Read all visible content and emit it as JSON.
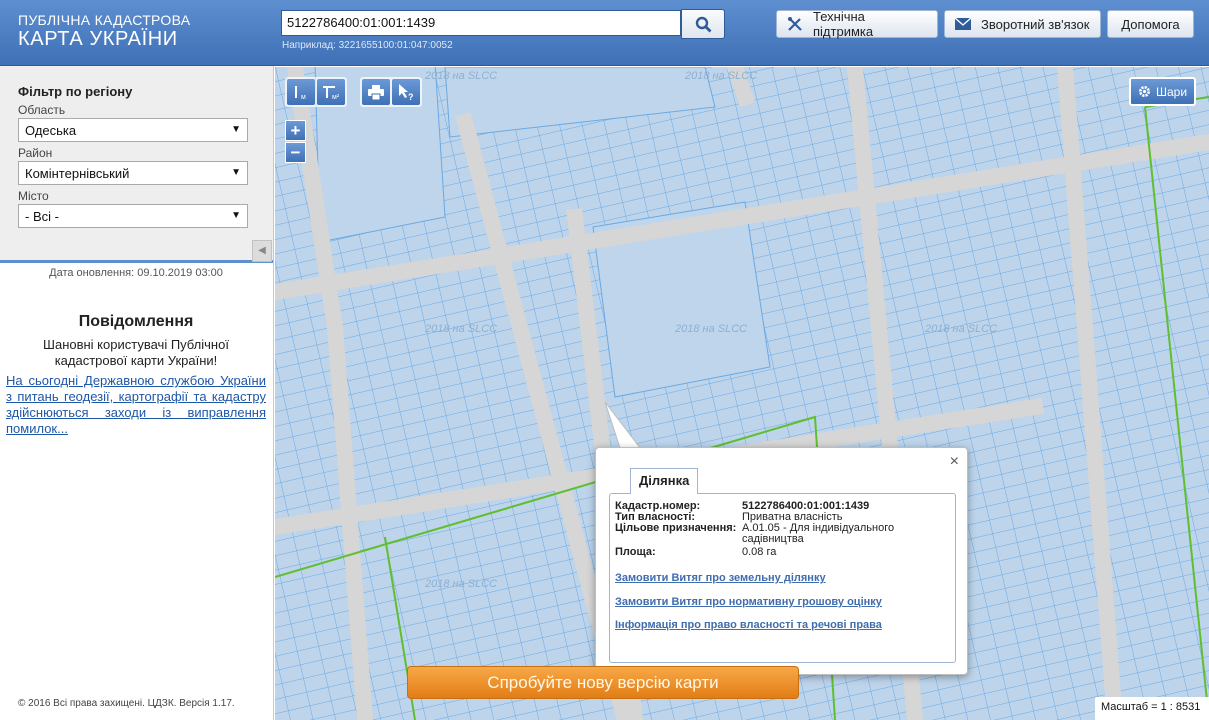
{
  "header": {
    "logo_line1": "ПУБЛІЧНА КАДАСТРОВА",
    "logo_line2": "КАРТА УКРАЇНИ",
    "search_value": "5122786400:01:001:1439",
    "search_hint": "Наприклад: 3221655100:01:047:0052",
    "btn_support": "Технічна підтримка",
    "btn_feedback": "Зворотний зв'язок",
    "btn_help": "Допомога"
  },
  "sidebar": {
    "filter_title": "Фільтр по регіону",
    "oblast_label": "Область",
    "oblast_value": "Одеська",
    "rayon_label": "Район",
    "rayon_value": "Комінтернівський",
    "misto_label": "Місто",
    "misto_value": "- Всі -",
    "updated": "Дата оновлення: 09.10.2019 03:00",
    "notif_title": "Повідомлення",
    "notif_greeting": "Шановні користувачі Публічної кадастрової карти України!",
    "notif_link": "На сьогодні Державною службою України з питань геодезії, картографії та кадастру здійснюються заходи із виправлення помилок...",
    "copyright": "© 2016 Всі права захищені. ЦДЗК. Версія 1.17."
  },
  "map": {
    "layers_label": "Шари",
    "watermark": "2018 на SLCC",
    "new_version": "Спробуйте нову версію карти",
    "scale": "Масштаб = 1 : 8531",
    "popup": {
      "tab": "Ділянка",
      "close": "×",
      "rows": [
        {
          "k": "Кадастр.номер:",
          "v": "5122786400:01:001:1439"
        },
        {
          "k": "Тип власності:",
          "v": "Приватна власність"
        },
        {
          "k": "Цільове призначення:",
          "v": "А.01.05 - Для індивідуального садівництва"
        },
        {
          "k": "Площа:",
          "v": "0.08 га"
        }
      ],
      "link1": "Замовити Витяг про земельну ділянку",
      "link2": "Замовити Витяг про нормативну грошову оцінку",
      "link3": "Інформація про право власності та речові права"
    }
  }
}
